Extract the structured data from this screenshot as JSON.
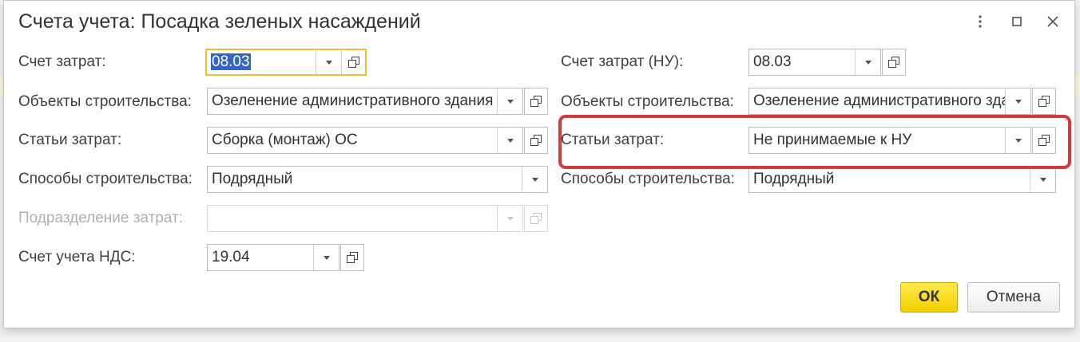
{
  "window": {
    "title": "Счета учета: Посадка зеленых насаждений"
  },
  "left": {
    "cost_account": {
      "label": "Счет затрат:",
      "value": "08.03"
    },
    "construction_objects": {
      "label": "Объекты строительства:",
      "value": "Озеленение административного здания"
    },
    "cost_items": {
      "label": "Статьи затрат:",
      "value": "Сборка (монтаж) ОС"
    },
    "construction_methods": {
      "label": "Способы строительства:",
      "value": "Подрядный"
    },
    "cost_department": {
      "label": "Подразделение затрат:",
      "value": ""
    },
    "vat_account": {
      "label": "Счет учета НДС:",
      "value": "19.04"
    }
  },
  "right": {
    "cost_account_tax": {
      "label": "Счет затрат (НУ):",
      "value": "08.03"
    },
    "construction_objects": {
      "label": "Объекты строительства:",
      "value": "Озеленение административного здания"
    },
    "cost_items": {
      "label": "Статьи затрат:",
      "value": "Не принимаемые к НУ"
    },
    "construction_methods": {
      "label": "Способы строительства:",
      "value": "Подрядный"
    }
  },
  "buttons": {
    "ok": "ОК",
    "cancel": "Отмена"
  },
  "colors": {
    "highlight": "#d8393e",
    "ok_button": "#f3cf00",
    "focus_border": "#f0c233"
  }
}
